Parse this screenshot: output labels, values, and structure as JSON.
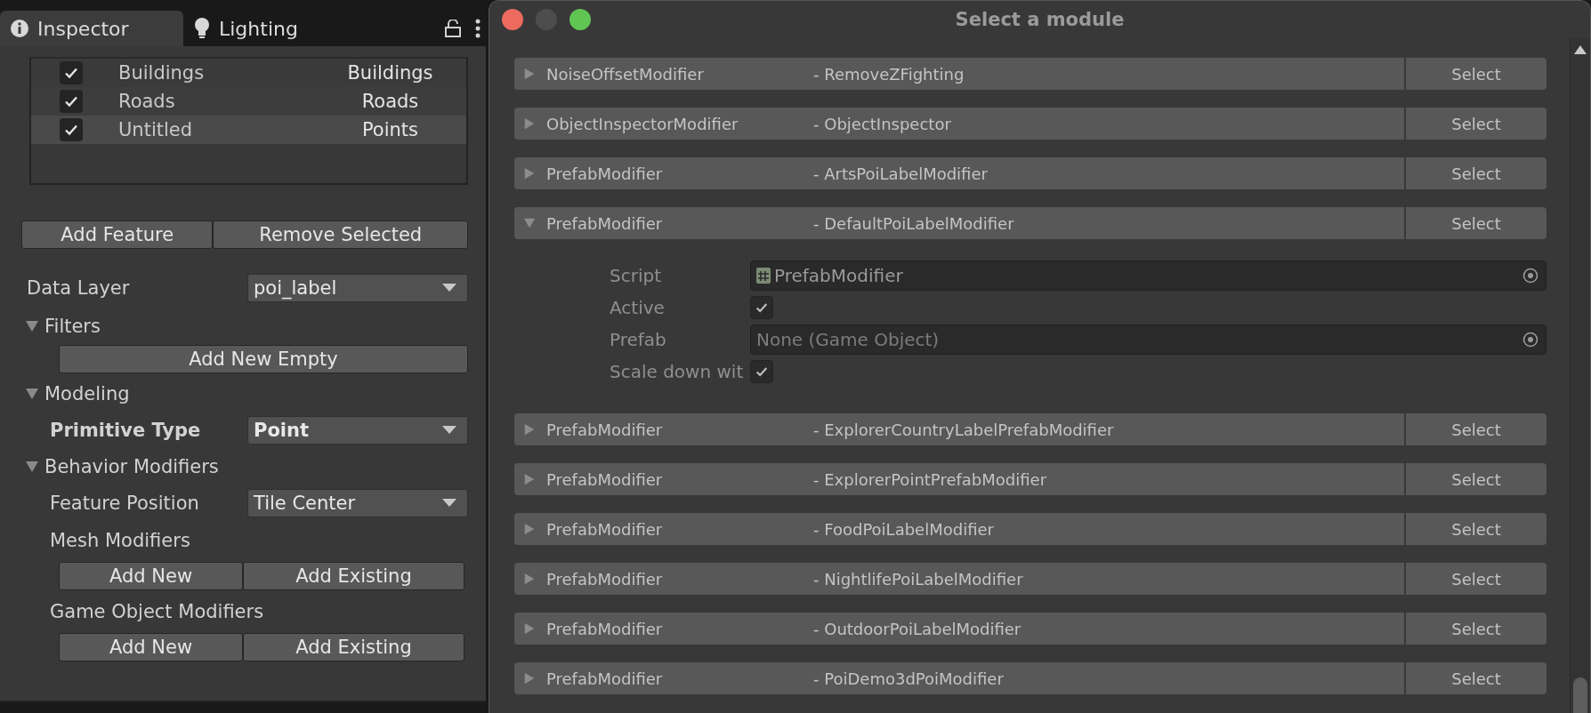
{
  "tabs": [
    {
      "label": "Inspector",
      "selected": true
    },
    {
      "label": "Lighting",
      "selected": false
    }
  ],
  "layers_table": {
    "rows": [
      {
        "checked": true,
        "name": "Buildings",
        "type": "Buildings",
        "selected": false
      },
      {
        "checked": true,
        "name": "Roads",
        "type": "Roads",
        "selected": false
      },
      {
        "checked": true,
        "name": "Untitled",
        "type": "Points",
        "selected": true
      }
    ]
  },
  "layer_buttons": [
    "Add Feature",
    "Remove Selected"
  ],
  "data_layer": {
    "label": "Data Layer",
    "value": "poi_label"
  },
  "filters": {
    "title": "Filters",
    "expanded": true,
    "button": "Add New Empty"
  },
  "modeling": {
    "title": "Modeling",
    "expanded": true,
    "primitive_type": {
      "label": "Primitive Type",
      "value": "Point"
    }
  },
  "behavior": {
    "title": "Behavior Modifiers",
    "expanded": true,
    "feature_position": {
      "label": "Feature Position",
      "value": "Tile Center"
    },
    "groups": [
      {
        "label": "Mesh Modifiers",
        "buttons": [
          "Add New",
          "Add Existing"
        ]
      },
      {
        "label": "Game Object Modifiers",
        "buttons": [
          "Add New",
          "Add Existing"
        ]
      }
    ]
  },
  "dialog": {
    "title": "Select a module",
    "modules": [
      {
        "type": "NoiseOffsetModifier",
        "name": "- RemoveZFighting",
        "expanded": false,
        "button": "Select"
      },
      {
        "type": "ObjectInspectorModifier",
        "name": "- ObjectInspector",
        "expanded": false,
        "button": "Select"
      },
      {
        "type": "PrefabModifier",
        "name": "- ArtsPoiLabelModifier",
        "expanded": false,
        "button": "Select"
      },
      {
        "type": "PrefabModifier",
        "name": "- DefaultPoiLabelModifier",
        "expanded": true,
        "button": "Select",
        "properties": [
          {
            "kind": "script",
            "label": "Script",
            "value": "PrefabModifier"
          },
          {
            "kind": "toggle",
            "label": "Active",
            "checked": true
          },
          {
            "kind": "object",
            "label": "Prefab",
            "value": "None (Game Object)"
          },
          {
            "kind": "toggle",
            "label": "Scale down wit",
            "checked": true
          }
        ]
      },
      {
        "type": "PrefabModifier",
        "name": "- ExplorerCountryLabelPrefabModifier",
        "expanded": false,
        "button": "Select"
      },
      {
        "type": "PrefabModifier",
        "name": "- ExplorerPointPrefabModifier",
        "expanded": false,
        "button": "Select"
      },
      {
        "type": "PrefabModifier",
        "name": "- FoodPoiLabelModifier",
        "expanded": false,
        "button": "Select"
      },
      {
        "type": "PrefabModifier",
        "name": "- NightlifePoiLabelModifier",
        "expanded": false,
        "button": "Select"
      },
      {
        "type": "PrefabModifier",
        "name": "- OutdoorPoiLabelModifier",
        "expanded": false,
        "button": "Select"
      },
      {
        "type": "PrefabModifier",
        "name": "- PoiDemo3dPoiModifier",
        "expanded": false,
        "button": "Select"
      }
    ]
  }
}
